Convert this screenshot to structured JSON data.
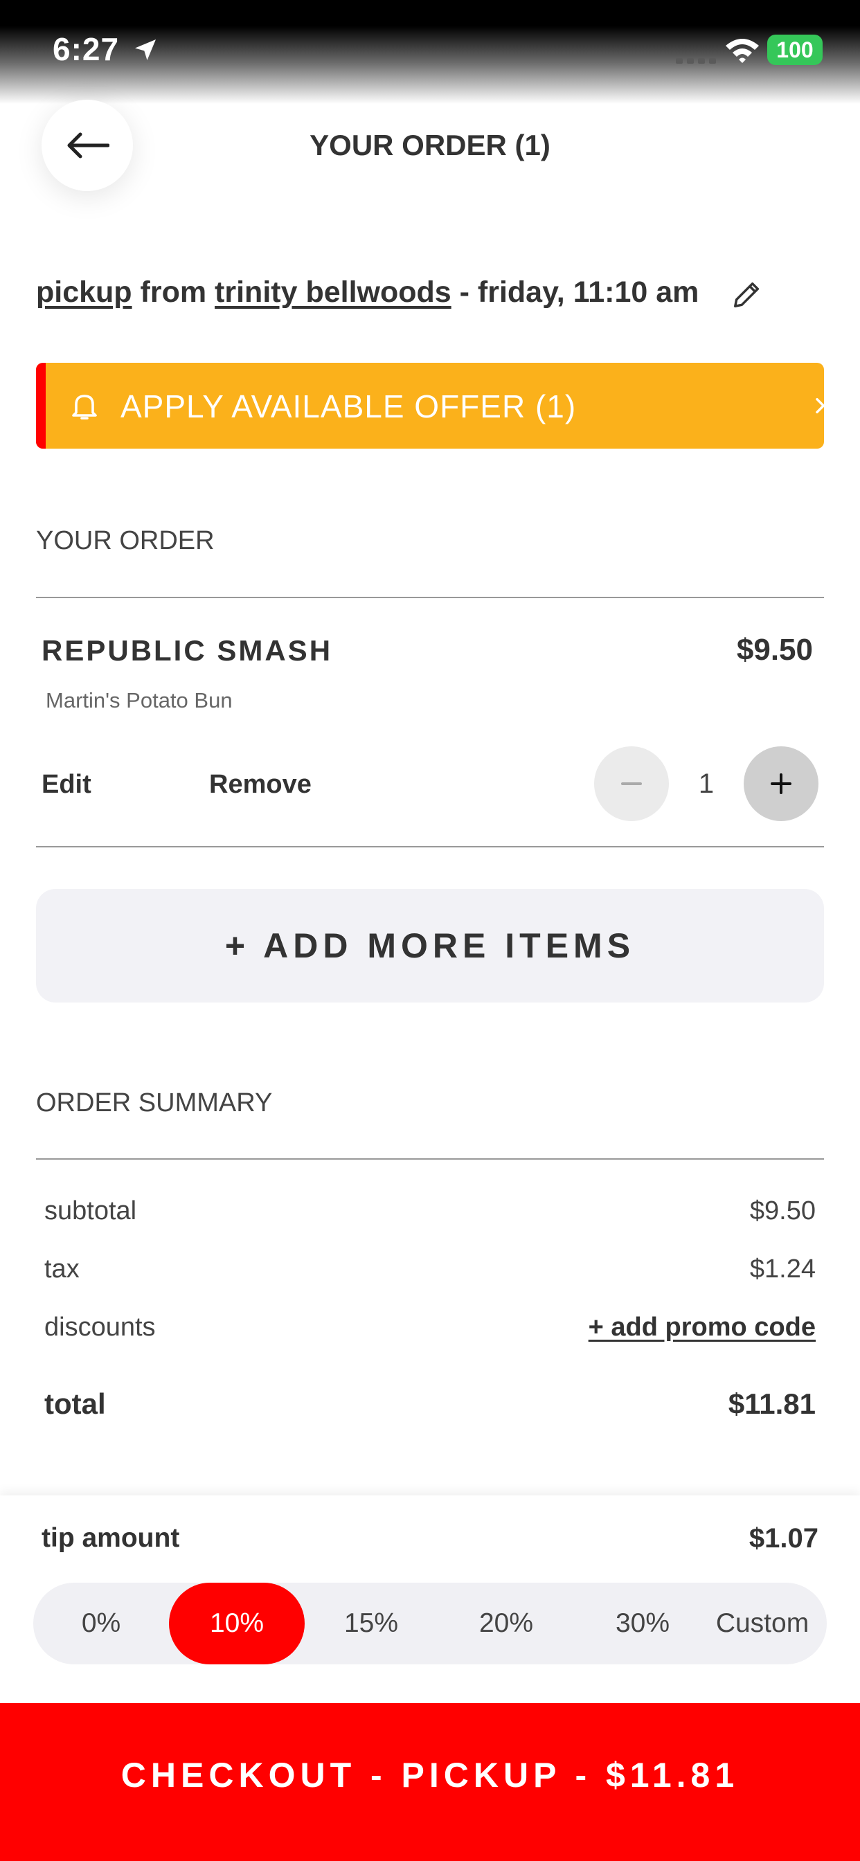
{
  "status_bar": {
    "time": "6:27",
    "battery": "100"
  },
  "header": {
    "title": "YOUR ORDER (1)"
  },
  "pickup": {
    "mode": "pickup",
    "from_word": "from",
    "location": "trinity bellwoods",
    "time": "- friday, 11:10 am"
  },
  "offer": {
    "label": "APPLY AVAILABLE OFFER (1)"
  },
  "order": {
    "section_label": "YOUR ORDER",
    "items": [
      {
        "name": "REPUBLIC SMASH",
        "price": "$9.50",
        "modifier": "Martin's Potato Bun",
        "edit_label": "Edit",
        "remove_label": "Remove",
        "quantity": "1"
      }
    ]
  },
  "add_more_label": "+ ADD MORE ITEMS",
  "summary": {
    "section_label": "ORDER SUMMARY",
    "subtotal_label": "subtotal",
    "subtotal_value": "$9.50",
    "tax_label": "tax",
    "tax_value": "$1.24",
    "discounts_label": "discounts",
    "promo_link": "+ add promo code",
    "total_label": "total",
    "total_value": "$11.81"
  },
  "tip": {
    "label": "tip amount",
    "amount": "$1.07",
    "options": [
      "0%",
      "10%",
      "15%",
      "20%",
      "30%",
      "Custom"
    ],
    "selected": "10%"
  },
  "checkout_label": "CHECKOUT - PICKUP - $11.81",
  "colors": {
    "brand_red": "#ff0000",
    "offer_yellow": "#fbb11b",
    "battery_green": "#35c759"
  }
}
